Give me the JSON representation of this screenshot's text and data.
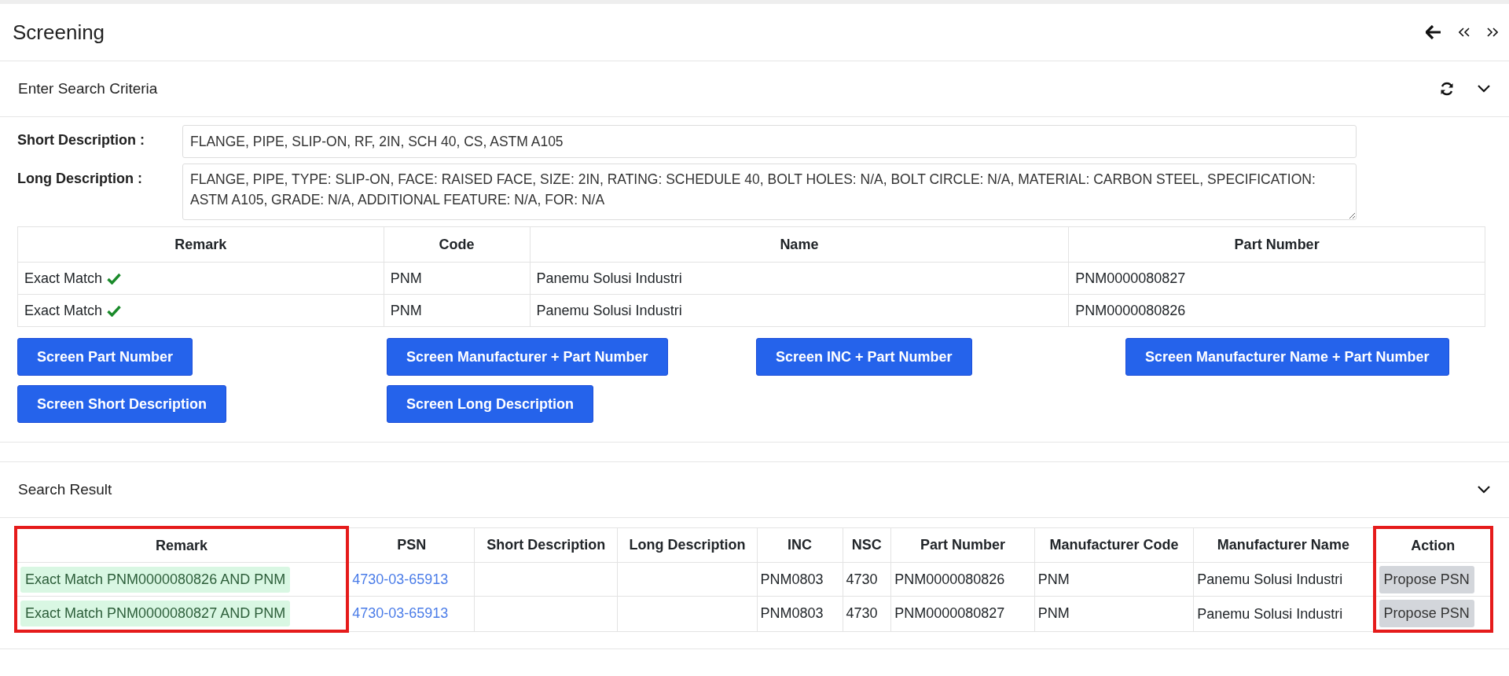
{
  "page": {
    "title": "Screening"
  },
  "criteria": {
    "title": "Enter Search Criteria",
    "expanded": true,
    "fields": [
      {
        "kind": "input",
        "label": "Short Description :",
        "value": "FLANGE, PIPE, SLIP-ON, RF, 2IN, SCH 40, CS, ASTM A105"
      },
      {
        "kind": "textarea",
        "label": "Long Description :",
        "value": "FLANGE, PIPE, TYPE: SLIP-ON, FACE: RAISED FACE, SIZE: 2IN, RATING: SCHEDULE 40, BOLT HOLES: N/A, BOLT CIRCLE: N/A, MATERIAL: CARBON STEEL, SPECIFICATION: ASTM A105, GRADE: N/A, ADDITIONAL FEATURE: N/A, FOR: N/A"
      }
    ],
    "table": {
      "columns": [
        "Remark",
        "Code",
        "Name",
        "Part Number"
      ],
      "rows": [
        {
          "remark": "Exact Match",
          "matched": true,
          "code": "PNM",
          "name": "Panemu Solusi Industri",
          "part_number": "PNM0000080827"
        },
        {
          "remark": "Exact Match",
          "matched": true,
          "code": "PNM",
          "name": "Panemu Solusi Industri",
          "part_number": "PNM0000080826"
        }
      ]
    },
    "buttons": [
      "Screen Part Number",
      "Screen Manufacturer + Part Number",
      "Screen INC + Part Number",
      "Screen Manufacturer Name + Part Number",
      "Screen Short Description",
      "Screen Long Description"
    ]
  },
  "results": {
    "title": "Search Result",
    "expanded": true,
    "columns": [
      {
        "label": "Remark",
        "highlighted": true
      },
      {
        "label": "PSN",
        "highlighted": false
      },
      {
        "label": "Short Description",
        "highlighted": false
      },
      {
        "label": "Long Description",
        "highlighted": false
      },
      {
        "label": "INC",
        "highlighted": false
      },
      {
        "label": "NSC",
        "highlighted": false
      },
      {
        "label": "Part Number",
        "highlighted": false
      },
      {
        "label": "Manufacturer Code",
        "highlighted": false
      },
      {
        "label": "Manufacturer Name",
        "highlighted": false
      },
      {
        "label": "Action",
        "highlighted": true
      }
    ],
    "rows": [
      {
        "remark": "Exact Match PNM0000080826 AND PNM",
        "psn": "4730-03-65913",
        "short_description": "",
        "long_description": "",
        "inc": "PNM0803",
        "nsc": "4730",
        "part_number": "PNM0000080826",
        "manufacturer_code": "PNM",
        "manufacturer_name": "Panemu Solusi Industri",
        "action": "Propose PSN"
      },
      {
        "remark": "Exact Match PNM0000080827 AND PNM",
        "psn": "4730-03-65913",
        "short_description": "",
        "long_description": "",
        "inc": "PNM0803",
        "nsc": "4730",
        "part_number": "PNM0000080827",
        "manufacturer_code": "PNM",
        "manufacturer_name": "Panemu Solusi Industri",
        "action": "Propose PSN"
      }
    ]
  }
}
